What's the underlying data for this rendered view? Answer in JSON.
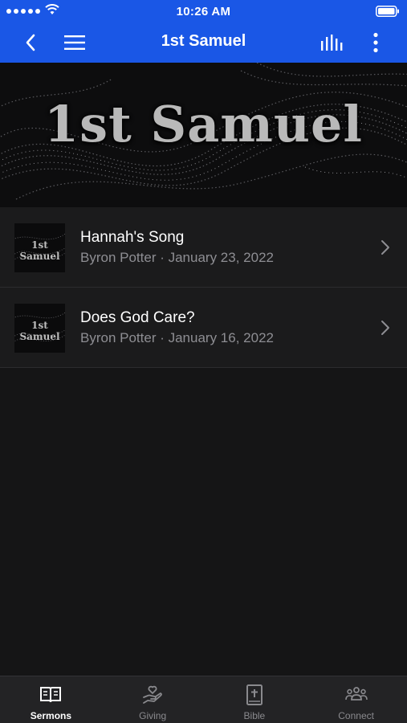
{
  "status_bar": {
    "time": "10:26 AM"
  },
  "nav": {
    "title": "1st Samuel"
  },
  "banner": {
    "title": "1st Samuel"
  },
  "sermons": [
    {
      "title": "Hannah's Song",
      "subtitle": "Byron Potter · January 23, 2022",
      "thumb_text": "1st Samuel"
    },
    {
      "title": "Does God Care?",
      "subtitle": "Byron Potter · January 16, 2022",
      "thumb_text": "1st Samuel"
    }
  ],
  "tabs": [
    {
      "label": "Sermons",
      "icon": "open-book-icon",
      "active": true
    },
    {
      "label": "Giving",
      "icon": "hand-heart-icon",
      "active": false
    },
    {
      "label": "Bible",
      "icon": "bible-icon",
      "active": false
    },
    {
      "label": "Connect",
      "icon": "people-icon",
      "active": false
    }
  ],
  "colors": {
    "nav_bg": "#1a57e6",
    "page_bg": "#151516",
    "row_bg": "#1b1b1c",
    "subtitle": "#8e8e93"
  }
}
